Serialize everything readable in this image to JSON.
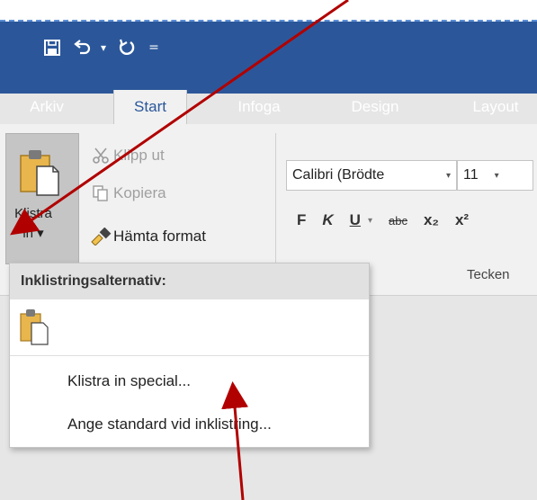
{
  "qat": {
    "save_icon": "save-icon",
    "undo_icon": "undo-icon",
    "undo_dropdown": "▾",
    "redo_icon": "redo-icon",
    "customize": "="
  },
  "tabs": [
    {
      "label": "Arkiv",
      "active": false
    },
    {
      "label": "Start",
      "active": true
    },
    {
      "label": "Infoga",
      "active": false
    },
    {
      "label": "Design",
      "active": false
    },
    {
      "label": "Layout",
      "active": false
    }
  ],
  "clipboard": {
    "paste_line1": "Klistra",
    "paste_line2": "in ▾",
    "cut_label": "Klipp ut",
    "copy_label": "Kopiera",
    "format_painter_label": "Hämta format"
  },
  "font": {
    "name": "Calibri (Brödte",
    "size": "11",
    "dropdown_arrow": "▾",
    "bold": "F",
    "italic": "K",
    "underline": "U",
    "strikethrough": "abc",
    "subscript": "x₂",
    "superscript": "x²",
    "group_label": "Tecken"
  },
  "paste_menu": {
    "header": "Inklistringsalternativ:",
    "item_special": "Klistra in special...",
    "item_default": "Ange standard vid inklistring..."
  },
  "colors": {
    "ribbon_blue": "#2b579a",
    "ribbon_body": "#f1f1f1",
    "arrow_red": "#b10000"
  }
}
